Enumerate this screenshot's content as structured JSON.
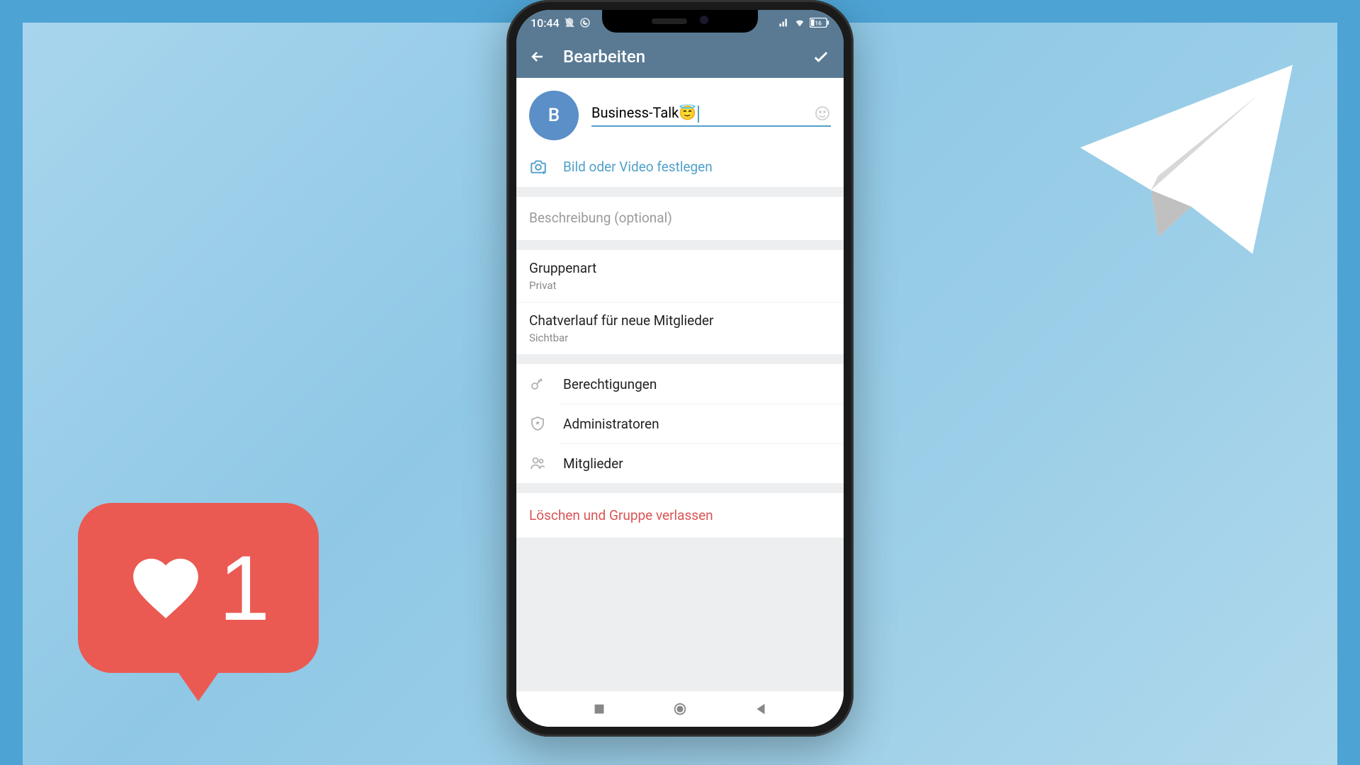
{
  "status": {
    "time": "10:44",
    "battery": "16"
  },
  "header": {
    "title": "Bearbeiten"
  },
  "group": {
    "avatar_letter": "B",
    "name": "Business-Talk😇",
    "set_media_label": "Bild oder Video festlegen",
    "description_placeholder": "Beschreibung (optional)"
  },
  "settings": {
    "group_type_title": "Gruppenart",
    "group_type_value": "Privat",
    "history_title": "Chatverlauf für neue Mitglieder",
    "history_value": "Sichtbar"
  },
  "rows": {
    "permissions": "Berechtigungen",
    "admins": "Administratoren",
    "members": "Mitglieder"
  },
  "danger": {
    "label": "Löschen und Gruppe verlassen"
  },
  "like": {
    "count": "1"
  }
}
